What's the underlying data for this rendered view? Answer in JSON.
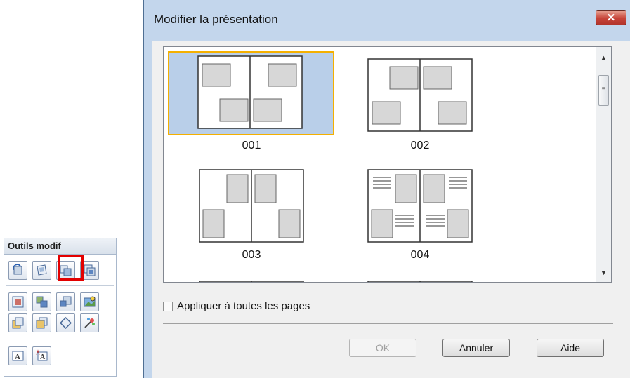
{
  "palette": {
    "title": "Outils modif",
    "rows": [
      [
        "rotate-icon",
        "flip-icon",
        "change-layout-icon",
        "change-background-icon"
      ],
      [
        "add-image-icon",
        "swap-images-icon",
        "move-image-icon",
        "image-correction-icon"
      ],
      [
        "send-backward-icon",
        "bring-forward-icon",
        "crop-icon",
        "effects-icon"
      ],
      [
        "add-text-icon",
        "edit-text-icon"
      ]
    ],
    "highlighted": "change-layout-icon"
  },
  "dialog": {
    "title": "Modifier la présentation",
    "close_label": "✕",
    "layouts": [
      {
        "label": "001",
        "selected": true
      },
      {
        "label": "002",
        "selected": false
      },
      {
        "label": "003",
        "selected": false
      },
      {
        "label": "004",
        "selected": false
      }
    ],
    "apply_all_label": "Appliquer à toutes les pages",
    "apply_all_checked": false,
    "ok_label": "OK",
    "cancel_label": "Annuler",
    "help_label": "Aide"
  },
  "colors": {
    "selection_bg": "#b9cfe9",
    "selection_border": "#f4b000",
    "highlight_frame": "#e30000",
    "title_bar": "#c3d6ec"
  }
}
